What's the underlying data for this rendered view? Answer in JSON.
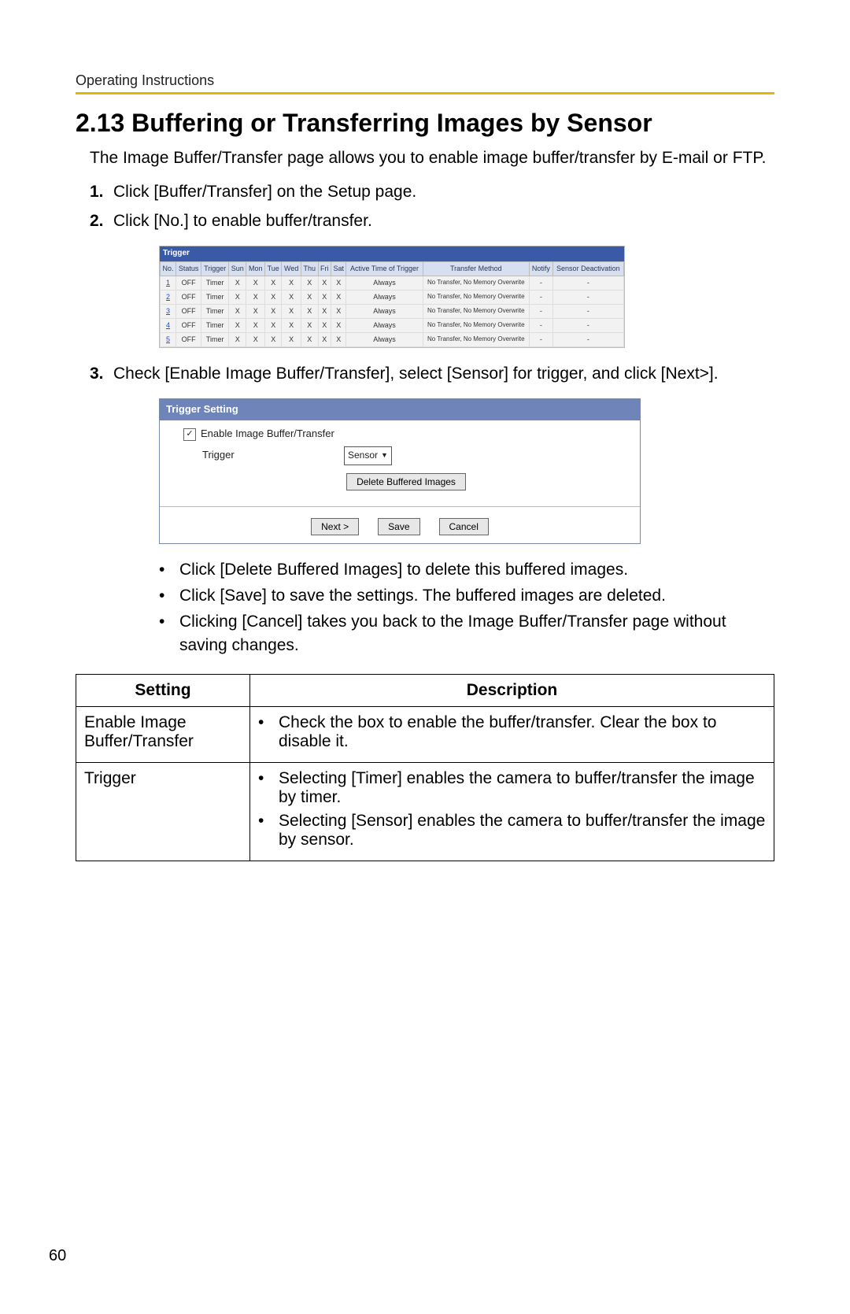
{
  "header": {
    "running_head": "Operating Instructions"
  },
  "section": {
    "title": "2.13  Buffering or Transferring Images by Sensor",
    "intro": "The Image Buffer/Transfer page allows you to enable image buffer/transfer by E-mail or FTP."
  },
  "steps": {
    "s1": {
      "num": "1.",
      "text": "Click [Buffer/Transfer] on the Setup page."
    },
    "s2": {
      "num": "2.",
      "text": "Click [No.] to enable buffer/transfer."
    },
    "s3": {
      "num": "3.",
      "text": "Check [Enable Image Buffer/Transfer], select [Sensor] for trigger, and click [Next>]."
    }
  },
  "trigger_table": {
    "title": "Trigger",
    "headers": {
      "no": "No.",
      "status": "Status",
      "trigger": "Trigger",
      "sun": "Sun",
      "mon": "Mon",
      "tue": "Tue",
      "wed": "Wed",
      "thu": "Thu",
      "fri": "Fri",
      "sat": "Sat",
      "active": "Active Time of Trigger",
      "method": "Transfer Method",
      "notify": "Notify",
      "sensor": "Sensor Deactivation"
    },
    "row": {
      "status": "OFF",
      "trig": "Timer",
      "x": "X",
      "active": "Always",
      "method": "No Transfer, No Memory Overwrite",
      "dash": "-"
    },
    "rows": [
      "1",
      "2",
      "3",
      "4",
      "5"
    ]
  },
  "ts": {
    "bar": "Trigger Setting",
    "check_label": "Enable Image Buffer/Transfer",
    "trig_label": "Trigger",
    "select_value": "Sensor",
    "delete_btn": "Delete Buffered Images",
    "next_btn": "Next >",
    "save_btn": "Save",
    "cancel_btn": "Cancel"
  },
  "sub_bullets": {
    "b1": "Click [Delete Buffered Images] to delete this buffered images.",
    "b2": "Click [Save] to save the settings. The buffered images are deleted.",
    "b3": "Clicking [Cancel] takes you back to the Image Buffer/Transfer page without saving changes."
  },
  "settings_table": {
    "h1": "Setting",
    "h2": "Description",
    "r1": {
      "setting": "Enable Image Buffer/Transfer",
      "d1": "Check the box to enable the buffer/transfer. Clear the box to disable it."
    },
    "r2": {
      "setting": "Trigger",
      "d1": "Selecting [Timer] enables the camera to buffer/transfer the image by timer.",
      "d2": "Selecting [Sensor] enables the camera to buffer/transfer the image by sensor."
    }
  },
  "page_number": "60"
}
